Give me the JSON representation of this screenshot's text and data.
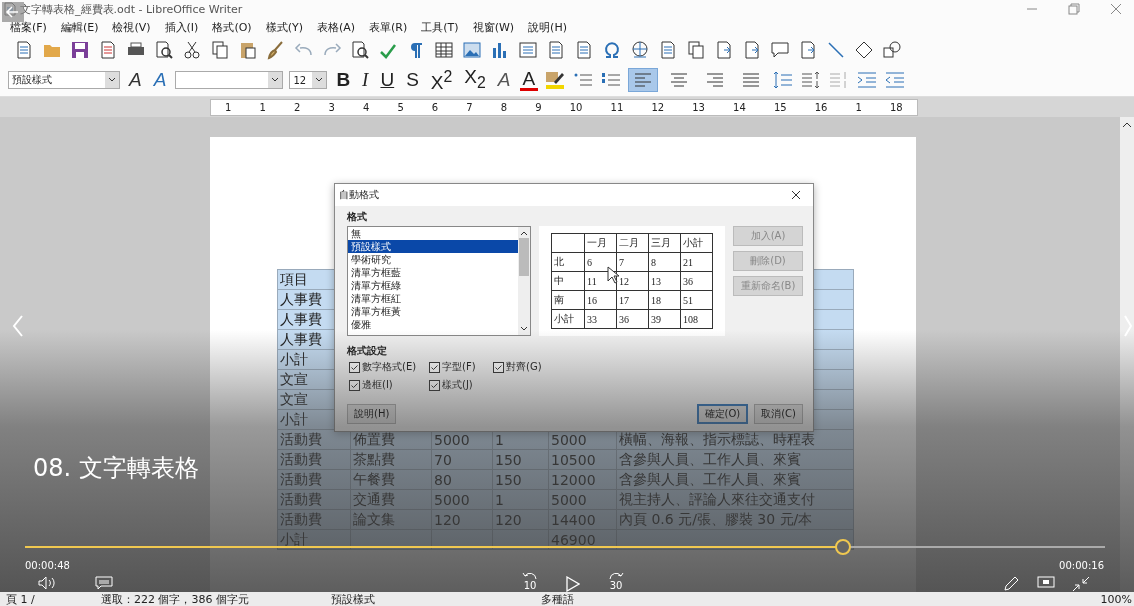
{
  "window": {
    "title": "文字轉表格_經費表.odt - LibreOffice Writer"
  },
  "menu": [
    "檔案(F)",
    "編輯(E)",
    "檢視(V)",
    "插入(I)",
    "格式(O)",
    "樣式(Y)",
    "表格(A)",
    "表單(R)",
    "工具(T)",
    "視窗(W)",
    "說明(H)"
  ],
  "toolbar": {
    "paragraph_style": "預設樣式",
    "font_size": "12",
    "style_tools": [
      {
        "kind": "update",
        "label": "A"
      },
      {
        "kind": "new",
        "label": "A"
      }
    ],
    "format_buttons": [
      {
        "kind": "bold",
        "label": "B"
      },
      {
        "kind": "italic",
        "label": "I"
      },
      {
        "kind": "underline",
        "label": "U"
      },
      {
        "kind": "strike",
        "label": "S"
      },
      {
        "kind": "script",
        "label": "X$^{2}$"
      },
      {
        "kind": "script",
        "label": "X$_{2}$"
      }
    ],
    "color_buttons": [
      {
        "kind": "clear",
        "label": "A"
      },
      {
        "kind": "font_color",
        "label": "A"
      }
    ],
    "alignment": [
      {
        "kind": "left",
        "selected": true
      },
      {
        "kind": "center",
        "selected": false
      },
      {
        "kind": "right",
        "selected": false
      },
      {
        "kind": "justify",
        "selected": false
      }
    ]
  },
  "ruler": {
    "marks": [
      "1",
      "1",
      "2",
      "3",
      "4",
      "5",
      "6",
      "7",
      "8",
      "9",
      "10",
      "11",
      "12",
      "13",
      "14",
      "15",
      "16",
      "1",
      "18"
    ]
  },
  "document": {
    "table": {
      "selected": true,
      "rows": [
        {
          "col_1": "項目"
        },
        {
          "col_1": "人事費"
        },
        {
          "col_1": "人事費"
        },
        {
          "col_1": "人事費"
        },
        {
          "col_1": "小計"
        },
        {
          "col_1": "文宣"
        },
        {
          "col_1": "文宣"
        },
        {
          "col_1": "小計"
        },
        {
          "col_1": "活動費",
          "col_2": "佈置費",
          "col_3": "5000",
          "col_4": "1",
          "col_5": "5000",
          "col_6": "橫幅、海報、指示標誌、時程表"
        },
        {
          "col_1": "活動費",
          "col_2": "茶點費",
          "col_3": "70",
          "col_4": "150",
          "col_5": "10500",
          "col_6": "含參與人員、工作人員、來賓"
        },
        {
          "col_1": "活動費",
          "col_2": "午餐費",
          "col_3": "80",
          "col_4": "150",
          "col_5": "12000",
          "col_6": "含參與人員、工作人員、來賓"
        },
        {
          "col_1": "活動費",
          "col_2": "交通費",
          "col_3": "5000",
          "col_4": "1",
          "col_5": "5000",
          "col_6": "視主持人、評論人來往交通支付"
        },
        {
          "col_1": "活動費",
          "col_2": "論文集",
          "col_3": "120",
          "col_4": "120",
          "col_5": "14400",
          "col_6": "內頁 0.6 元/張、膠裝 30 元/本"
        },
        {
          "col_1": "小計",
          "col_5": "46900"
        }
      ]
    }
  },
  "dialog": {
    "title": "自動格式",
    "format_heading": "格式",
    "formats": [
      {
        "label": "無",
        "selected": false
      },
      {
        "label": "預設樣式",
        "selected": true
      },
      {
        "label": "學術研究",
        "selected": false
      },
      {
        "label": "清單方框藍",
        "selected": false
      },
      {
        "label": "清單方框綠",
        "selected": false
      },
      {
        "label": "清單方框紅",
        "selected": false
      },
      {
        "label": "清單方框黃",
        "selected": false
      },
      {
        "label": "優雅",
        "selected": false
      }
    ],
    "preview": {
      "columns": [
        "一月",
        "二月",
        "三月",
        "小計"
      ],
      "rows": [
        {
          "label": "北",
          "values": [
            "6",
            "7",
            "8",
            "21"
          ]
        },
        {
          "label": "中",
          "values": [
            "11",
            "12",
            "13",
            "36"
          ]
        },
        {
          "label": "南",
          "values": [
            "16",
            "17",
            "18",
            "51"
          ]
        },
        {
          "label": "小計",
          "values": [
            "33",
            "36",
            "39",
            "108"
          ]
        }
      ]
    },
    "side_buttons": [
      {
        "label": "加入(A)",
        "disabled": true
      },
      {
        "label": "刪除(D)",
        "disabled": true
      },
      {
        "label": "重新命名(B)",
        "disabled": true
      }
    ],
    "settings_heading": "格式設定",
    "options": [
      {
        "label": "數字格式(E)",
        "checked": true
      },
      {
        "label": "字型(F)",
        "checked": true
      },
      {
        "label": "對齊(G)",
        "checked": true
      },
      {
        "label": "邊框(I)",
        "checked": true
      },
      {
        "label": "樣式(J)",
        "checked": true
      }
    ],
    "help_button": "說明(H)",
    "buttons": [
      {
        "label": "確定(O)",
        "default": true
      },
      {
        "label": "取消(C)",
        "default": false
      }
    ]
  },
  "video": {
    "title": "08. 文字轉表格",
    "level": 0.757,
    "elapsed": "00:00:48",
    "remaining": "00:00:16",
    "rewind": "10",
    "forward": "30"
  },
  "status_bar": [
    "頁 1 /",
    "選取：222 個字，386 個字元",
    "預設樣式",
    "多種語",
    "100%"
  ]
}
